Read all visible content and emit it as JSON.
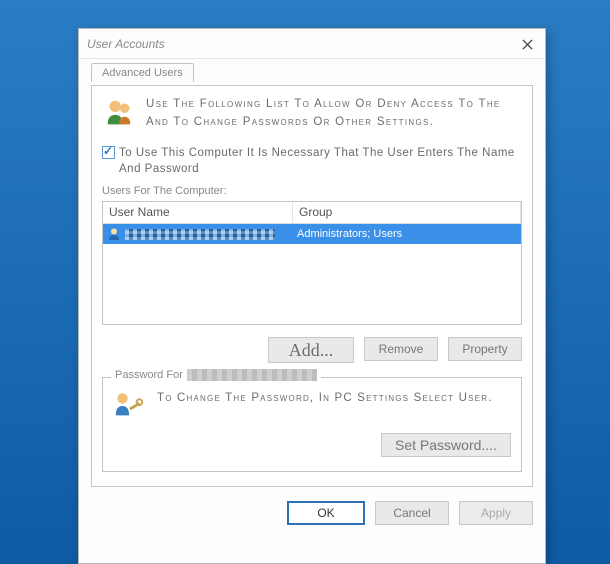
{
  "window": {
    "title": "User Accounts"
  },
  "tabs": {
    "advanced": "Advanced Users"
  },
  "intro": "Use The Following List To Allow Or Deny Access To The And To Change Passwords Or Other Settings.",
  "check": {
    "checked": true,
    "label": "To Use This Computer It Is Necessary That The User Enters The Name And Password"
  },
  "list": {
    "caption": "Users For The Computer:",
    "headers": {
      "username": "User Name",
      "group": "Group"
    },
    "rows": [
      {
        "username_redacted": true,
        "group": "Administrators; Users",
        "selected": true
      }
    ]
  },
  "buttons": {
    "add": "Add...",
    "remove": "Remove",
    "property": "Property",
    "set_password": "Set Password....",
    "ok": "OK",
    "cancel": "Cancel",
    "apply": "Apply"
  },
  "password_section": {
    "legend_prefix": "Password For",
    "text": "To Change The Password, In PC Settings Select User."
  }
}
